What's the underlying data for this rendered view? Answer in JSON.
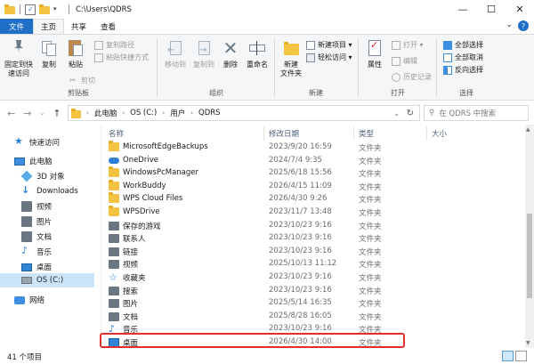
{
  "window": {
    "path_title": "C:\\Users\\QDRS",
    "min_label": "—",
    "max_label": "☐",
    "close_label": "✕"
  },
  "tabs": [
    {
      "label": "文件"
    },
    {
      "label": "主页"
    },
    {
      "label": "共享"
    },
    {
      "label": "查看"
    }
  ],
  "ribbon": {
    "clipboard": {
      "pin_label": "固定到快\n速访问",
      "copy_label": "复制",
      "paste_label": "粘贴",
      "copy_path_label": "复制路径",
      "paste_shortcut_label": "粘贴快捷方式",
      "cut_label": "剪切",
      "group_label": "剪贴板"
    },
    "organize": {
      "move_to_label": "移动到",
      "copy_to_label": "复制到",
      "delete_label": "删除",
      "rename_label": "重命名",
      "group_label": "组织"
    },
    "new": {
      "new_folder_label": "新建\n文件夹",
      "new_item_label": "新建项目 ▾",
      "easy_access_label": "轻松访问 ▾",
      "group_label": "新建"
    },
    "open": {
      "properties_label": "属性",
      "open_label": "打开 ▾",
      "edit_label": "编辑",
      "history_label": "历史记录",
      "group_label": "打开"
    },
    "select": {
      "select_all_label": "全部选择",
      "select_none_label": "全部取消",
      "invert_label": "反向选择",
      "group_label": "选择"
    }
  },
  "address": {
    "crumbs": [
      "此电脑",
      "OS (C:)",
      "用户",
      "QDRS"
    ],
    "search_placeholder": "在 QDRS 中搜索"
  },
  "navpane": [
    {
      "label": "快速访问",
      "icon": "star-icon"
    },
    {
      "label": "此电脑",
      "icon": "computer-icon"
    },
    {
      "label": "3D 对象",
      "icon": "3d-objects-icon"
    },
    {
      "label": "Downloads",
      "icon": "download-icon"
    },
    {
      "label": "视频",
      "icon": "video-icon"
    },
    {
      "label": "图片",
      "icon": "pictures-icon"
    },
    {
      "label": "文档",
      "icon": "documents-icon"
    },
    {
      "label": "音乐",
      "icon": "music-icon"
    },
    {
      "label": "桌面",
      "icon": "desktop-icon"
    },
    {
      "label": "OS (C:)",
      "icon": "drive-icon"
    },
    {
      "label": "网络",
      "icon": "network-icon"
    }
  ],
  "columns": {
    "name": "名称",
    "date": "修改日期",
    "type": "类型",
    "size": "大小"
  },
  "files": [
    {
      "name": "MicrosoftEdgeBackups",
      "date": "2023/9/20 16:59",
      "type": "文件夹",
      "icon": "folder-icon"
    },
    {
      "name": "OneDrive",
      "date": "2024/7/4 9:35",
      "type": "文件夹",
      "icon": "onedrive-cloud-icon"
    },
    {
      "name": "WindowsPcManager",
      "date": "2025/6/18 15:56",
      "type": "文件夹",
      "icon": "folder-icon"
    },
    {
      "name": "WorkBuddy",
      "date": "2026/4/15 11:09",
      "type": "文件夹",
      "icon": "folder-icon"
    },
    {
      "name": "WPS Cloud Files",
      "date": "2026/4/30 9:26",
      "type": "文件夹",
      "icon": "folder-icon"
    },
    {
      "name": "WPSDrive",
      "date": "2023/11/7 13:48",
      "type": "文件夹",
      "icon": "folder-icon"
    },
    {
      "name": "保存的游戏",
      "date": "2023/10/23 9:16",
      "type": "文件夹",
      "icon": "saved-games-icon"
    },
    {
      "name": "联系人",
      "date": "2023/10/23 9:16",
      "type": "文件夹",
      "icon": "contacts-icon"
    },
    {
      "name": "链接",
      "date": "2023/10/23 9:16",
      "type": "文件夹",
      "icon": "links-icon"
    },
    {
      "name": "视频",
      "date": "2025/10/13 11:12",
      "type": "文件夹",
      "icon": "video-icon"
    },
    {
      "name": "收藏夹",
      "date": "2023/10/23 9:16",
      "type": "文件夹",
      "icon": "favorites-star-icon"
    },
    {
      "name": "搜索",
      "date": "2023/10/23 9:16",
      "type": "文件夹",
      "icon": "search-folder-icon"
    },
    {
      "name": "图片",
      "date": "2025/5/14 16:35",
      "type": "文件夹",
      "icon": "pictures-icon"
    },
    {
      "name": "文档",
      "date": "2025/8/28 16:05",
      "type": "文件夹",
      "icon": "documents-icon"
    },
    {
      "name": "音乐",
      "date": "2023/10/23 9:16",
      "type": "文件夹",
      "icon": "music-icon"
    },
    {
      "name": "桌面",
      "date": "2026/4/30 14:00",
      "type": "文件夹",
      "icon": "desktop-icon"
    }
  ],
  "status": {
    "count": "41 个项目"
  },
  "colors": {
    "file_tab": "#1f6fc6",
    "selected_nav": "#cce4f7",
    "highlight_box": "#e03030",
    "folder": "#f5c342"
  }
}
